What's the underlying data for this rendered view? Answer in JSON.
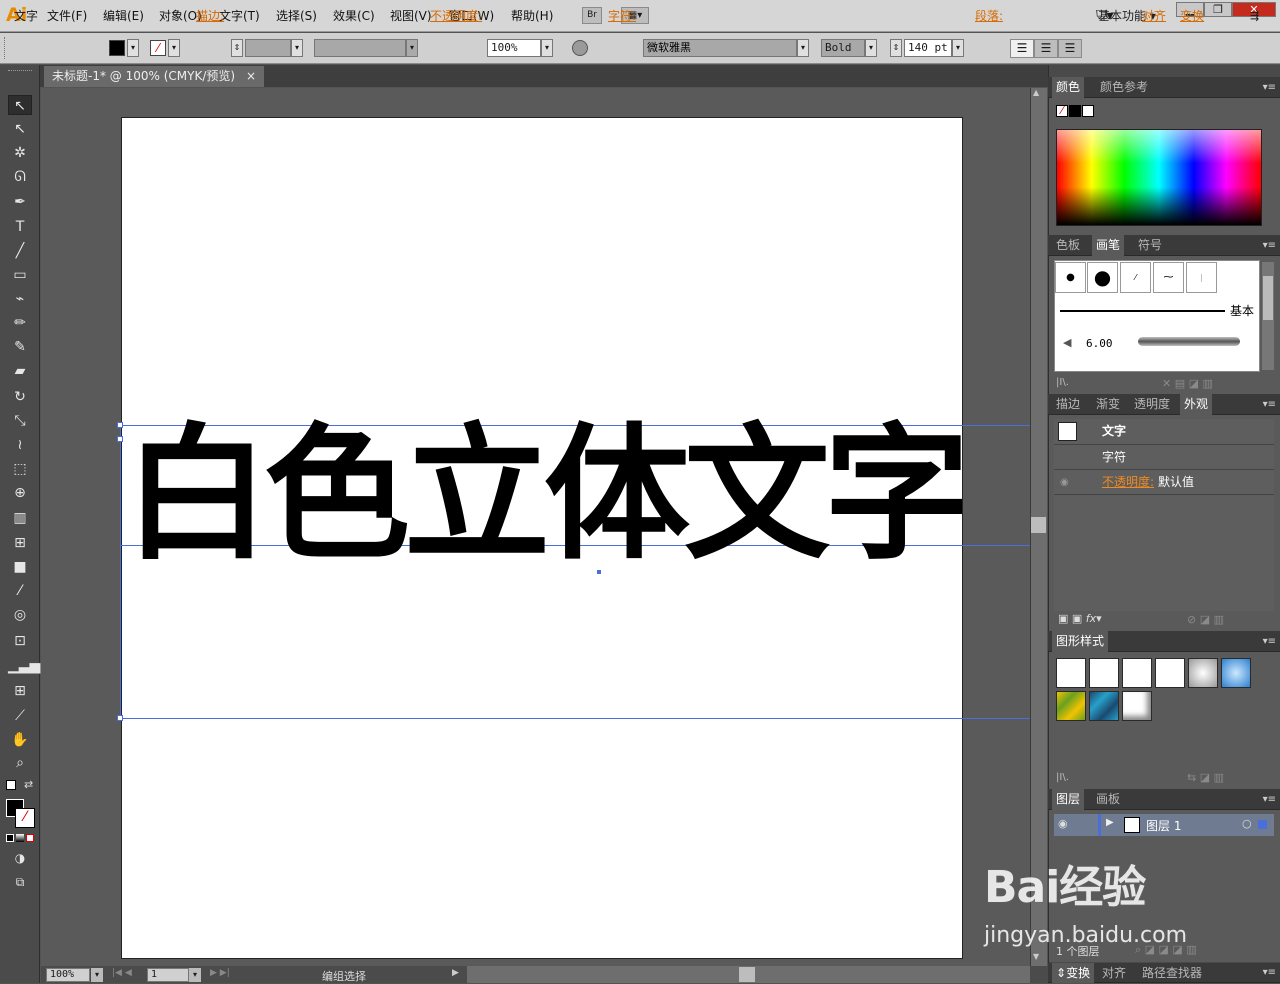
{
  "app": {
    "logo": "Ai",
    "workspace": "基本功能",
    "window_min": "▁",
    "window_max": "❐",
    "window_close": "✕"
  },
  "menu": [
    "文件(F)",
    "编辑(E)",
    "对象(O)",
    "文字(T)",
    "选择(S)",
    "效果(C)",
    "视图(V)",
    "窗口(W)",
    "帮助(H)"
  ],
  "menu_br": "Br",
  "control": {
    "context": "文字",
    "stroke_label": "描边:",
    "opacity_label": "不透明度:",
    "opacity_value": "100%",
    "char_label": "字符:",
    "font_name": "微软雅黑",
    "font_style": "Bold",
    "font_size": "140 pt",
    "para_label": "段落:",
    "align_label": "对齐",
    "transform_label": "变换"
  },
  "document": {
    "tab_title": "未标题-1* @ 100% (CMYK/预览)",
    "tab_close": "×",
    "text": "白色立体文字"
  },
  "status": {
    "zoom": "100%",
    "page": "1",
    "info": "编组选择"
  },
  "panels": {
    "color": {
      "tabs": [
        "颜色",
        "颜色参考"
      ]
    },
    "brush": {
      "tabs": [
        "色板",
        "画笔",
        "符号"
      ],
      "basic_label": "基本",
      "size_label": "6.00"
    },
    "appearance": {
      "tabs": [
        "描边",
        "渐变",
        "透明度",
        "外观"
      ],
      "row_title": "文字",
      "row_char": "字符",
      "opacity_label": "不透明度:",
      "opacity_value": "默认值"
    },
    "graphic_styles": {
      "tabs": [
        "图形样式"
      ]
    },
    "layers": {
      "tabs": [
        "图层",
        "画板"
      ],
      "layer_name": "图层 1",
      "footer": "1 个图层"
    },
    "bottom": {
      "tabs": [
        "变换",
        "对齐",
        "路径查找器"
      ]
    }
  },
  "watermark": {
    "text": "Bai经验",
    "url": "jingyan.baidu.com"
  },
  "colors": {
    "accent_orange": "#d86a00",
    "guide_blue": "#4a6fd8",
    "panel_bg": "#535353"
  }
}
